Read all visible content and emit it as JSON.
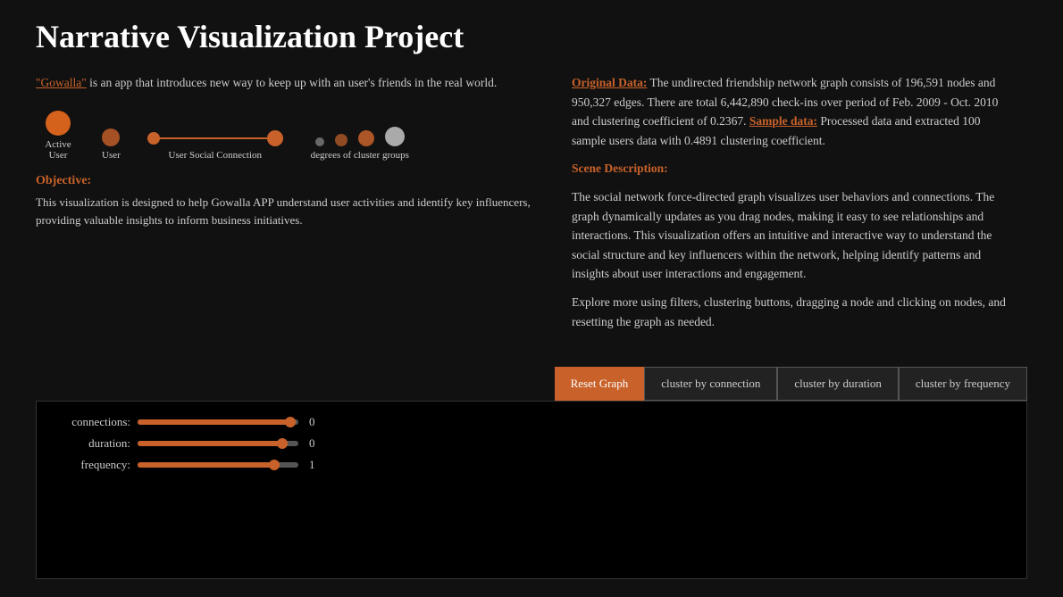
{
  "page": {
    "title": "Narrative Visualization Project"
  },
  "intro": {
    "link_text": "\"Gowalla\"",
    "text_after": "is an app that introduces new way to keep up with an user's friends in the real world."
  },
  "legend": {
    "active_user_label": "Active User",
    "user_label": "User",
    "social_connection_label": "User Social Connection",
    "degrees_label": "degrees of cluster groups"
  },
  "objective": {
    "title": "Objective:",
    "text": "This visualization is designed to help Gowalla APP understand user activities and identify key influencers, providing valuable insights to inform business initiatives."
  },
  "right_panel": {
    "original_data_label": "Original Data:",
    "original_data_text": " The undirected friendship network graph consists of 196,591 nodes and 950,327 edges. There are total 6,442,890 check-ins over period of Feb. 2009 - Oct. 2010 and clustering coefficient of 0.2367.",
    "sample_data_label": "Sample data:",
    "sample_data_text": " Processed data and extracted 100 sample users data with 0.4891 clustering coefficient.",
    "scene_label": "Scene Description:",
    "scene_text": "The social network force-directed graph visualizes user behaviors and connections. The graph dynamically updates as you drag nodes, making it easy to see relationships and interactions. This visualization offers an intuitive and interactive way to understand the social structure and key influencers within the network, helping identify patterns and insights about user interactions and engagement.",
    "explore_text": "Explore more using filters, clustering buttons, dragging a node and clicking on nodes, and resetting the graph as needed."
  },
  "buttons": {
    "reset": "Reset Graph",
    "cluster_connection": "cluster by connection",
    "cluster_duration": "cluster by duration",
    "cluster_frequency": "cluster by frequency"
  },
  "filters": {
    "connections_label": "connections:",
    "connections_value": "0",
    "connections_fill_pct": 95,
    "duration_label": "duration:",
    "duration_value": "0",
    "duration_fill_pct": 90,
    "frequency_label": "frequency:",
    "frequency_value": "1",
    "frequency_fill_pct": 85
  }
}
